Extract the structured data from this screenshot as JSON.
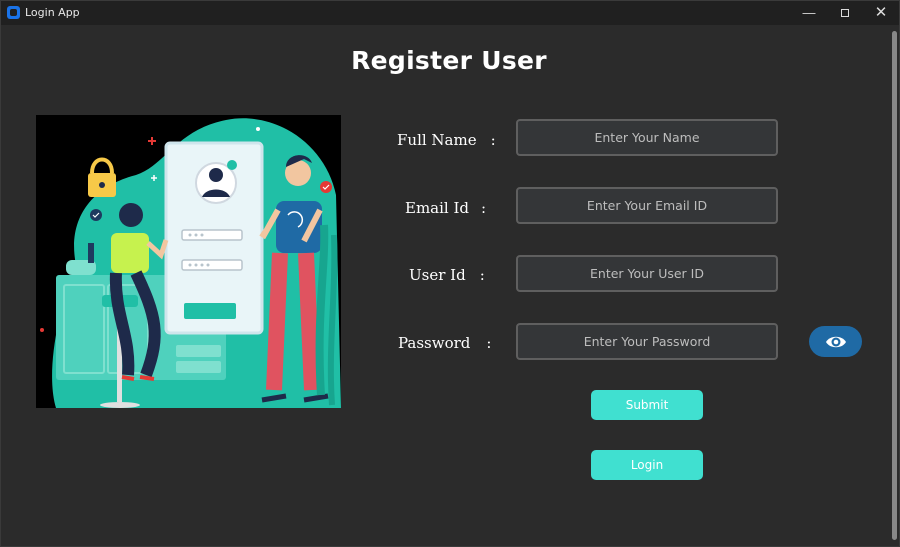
{
  "window": {
    "title": "Login App",
    "controls": {
      "minimize": "—",
      "close": "✕"
    }
  },
  "page": {
    "title": "Register User"
  },
  "form": {
    "fields": [
      {
        "label": "Full Name",
        "separator": ":",
        "placeholder": "Enter Your Name",
        "value": ""
      },
      {
        "label": "Email Id",
        "separator": ":",
        "placeholder": "Enter Your Email ID",
        "value": ""
      },
      {
        "label": "User Id",
        "separator": ":",
        "placeholder": "Enter Your User ID",
        "value": ""
      },
      {
        "label": "Password",
        "separator": ":",
        "placeholder": "Enter Your Password",
        "value": ""
      }
    ],
    "toggle_password_icon": "eye-icon",
    "submit_label": "Submit",
    "login_label": "Login"
  },
  "colors": {
    "background": "#2b2b2b",
    "input_background": "#343638",
    "input_border": "#5f5f5f",
    "action_button": "#40e0d0",
    "toggle_button": "#1f6aa5",
    "illustration_teal": "#20bfa6"
  }
}
